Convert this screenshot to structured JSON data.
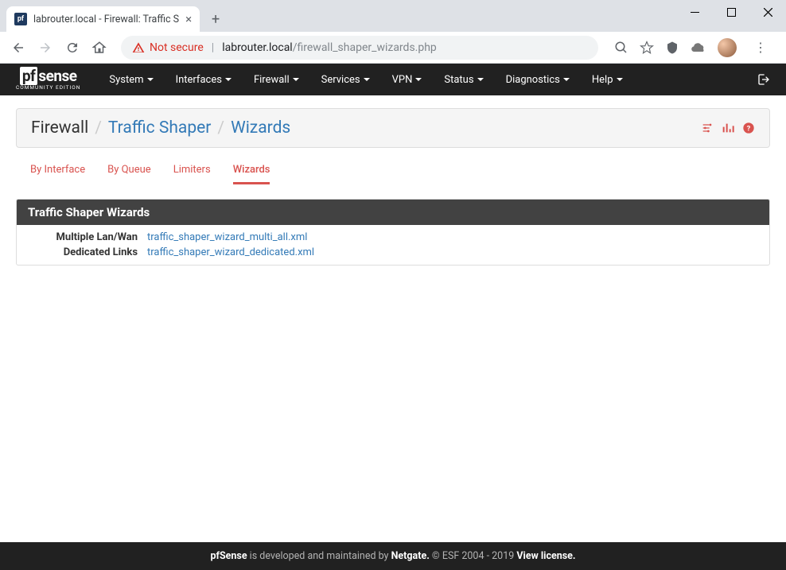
{
  "browser": {
    "tab_title": "labrouter.local - Firewall: Traffic S",
    "favicon_text": "pf",
    "security_label": "Not secure",
    "url_host": "labrouter.local",
    "url_path": "/firewall_shaper_wizards.php"
  },
  "navbar": {
    "logo_top_box": "pf",
    "logo_top_rest": "sense",
    "logo_bottom": "COMMUNITY EDITION",
    "items": [
      "System",
      "Interfaces",
      "Firewall",
      "Services",
      "VPN",
      "Status",
      "Diagnostics",
      "Help"
    ]
  },
  "breadcrumb": {
    "parts": [
      "Firewall",
      "Traffic Shaper",
      "Wizards"
    ]
  },
  "tabs": [
    "By Interface",
    "By Queue",
    "Limiters",
    "Wizards"
  ],
  "active_tab_index": 3,
  "panel": {
    "title": "Traffic Shaper Wizards",
    "rows": [
      {
        "label": "Multiple Lan/Wan",
        "link": "traffic_shaper_wizard_multi_all.xml"
      },
      {
        "label": "Dedicated Links",
        "link": "traffic_shaper_wizard_dedicated.xml"
      }
    ]
  },
  "footer": {
    "brand": "pfSense",
    "mid": " is developed and maintained by ",
    "netgate": "Netgate.",
    "copy": " © ESF 2004 - 2019 ",
    "license": "View license."
  }
}
